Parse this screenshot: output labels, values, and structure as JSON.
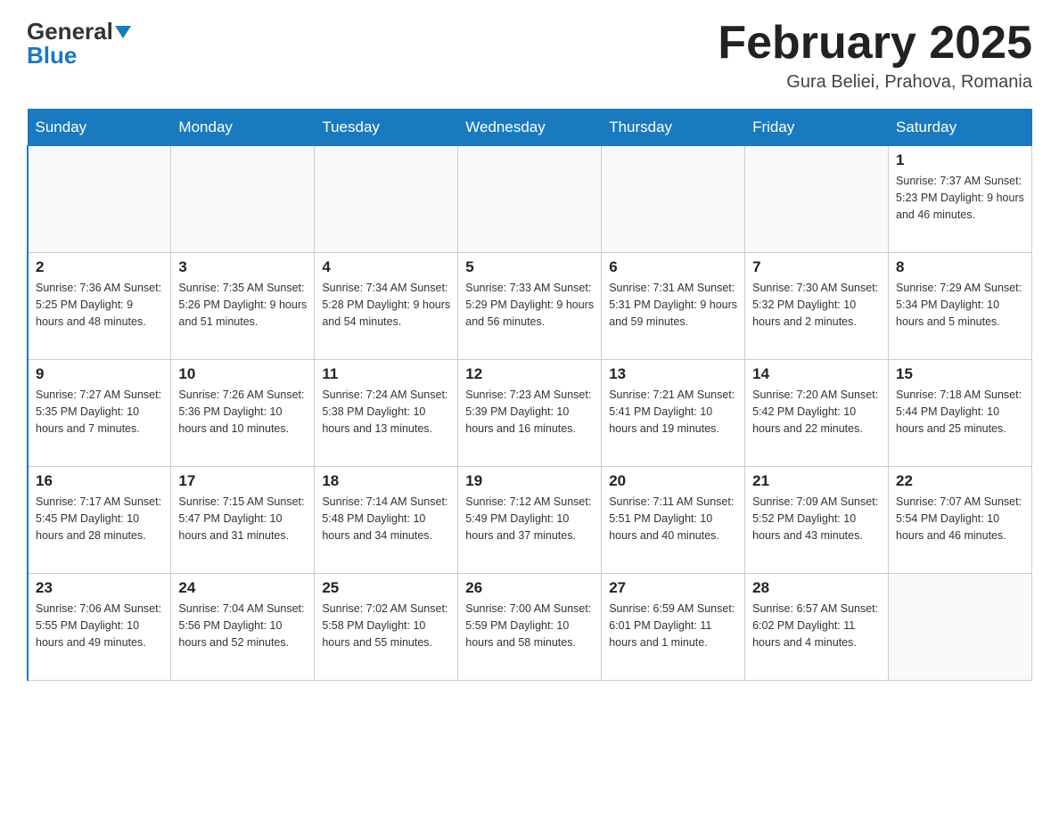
{
  "header": {
    "logo_line1": "General",
    "logo_line2": "Blue",
    "month_title": "February 2025",
    "location": "Gura Beliei, Prahova, Romania"
  },
  "days_of_week": [
    "Sunday",
    "Monday",
    "Tuesday",
    "Wednesday",
    "Thursday",
    "Friday",
    "Saturday"
  ],
  "weeks": [
    [
      {
        "day": "",
        "info": ""
      },
      {
        "day": "",
        "info": ""
      },
      {
        "day": "",
        "info": ""
      },
      {
        "day": "",
        "info": ""
      },
      {
        "day": "",
        "info": ""
      },
      {
        "day": "",
        "info": ""
      },
      {
        "day": "1",
        "info": "Sunrise: 7:37 AM\nSunset: 5:23 PM\nDaylight: 9 hours\nand 46 minutes."
      }
    ],
    [
      {
        "day": "2",
        "info": "Sunrise: 7:36 AM\nSunset: 5:25 PM\nDaylight: 9 hours\nand 48 minutes."
      },
      {
        "day": "3",
        "info": "Sunrise: 7:35 AM\nSunset: 5:26 PM\nDaylight: 9 hours\nand 51 minutes."
      },
      {
        "day": "4",
        "info": "Sunrise: 7:34 AM\nSunset: 5:28 PM\nDaylight: 9 hours\nand 54 minutes."
      },
      {
        "day": "5",
        "info": "Sunrise: 7:33 AM\nSunset: 5:29 PM\nDaylight: 9 hours\nand 56 minutes."
      },
      {
        "day": "6",
        "info": "Sunrise: 7:31 AM\nSunset: 5:31 PM\nDaylight: 9 hours\nand 59 minutes."
      },
      {
        "day": "7",
        "info": "Sunrise: 7:30 AM\nSunset: 5:32 PM\nDaylight: 10 hours\nand 2 minutes."
      },
      {
        "day": "8",
        "info": "Sunrise: 7:29 AM\nSunset: 5:34 PM\nDaylight: 10 hours\nand 5 minutes."
      }
    ],
    [
      {
        "day": "9",
        "info": "Sunrise: 7:27 AM\nSunset: 5:35 PM\nDaylight: 10 hours\nand 7 minutes."
      },
      {
        "day": "10",
        "info": "Sunrise: 7:26 AM\nSunset: 5:36 PM\nDaylight: 10 hours\nand 10 minutes."
      },
      {
        "day": "11",
        "info": "Sunrise: 7:24 AM\nSunset: 5:38 PM\nDaylight: 10 hours\nand 13 minutes."
      },
      {
        "day": "12",
        "info": "Sunrise: 7:23 AM\nSunset: 5:39 PM\nDaylight: 10 hours\nand 16 minutes."
      },
      {
        "day": "13",
        "info": "Sunrise: 7:21 AM\nSunset: 5:41 PM\nDaylight: 10 hours\nand 19 minutes."
      },
      {
        "day": "14",
        "info": "Sunrise: 7:20 AM\nSunset: 5:42 PM\nDaylight: 10 hours\nand 22 minutes."
      },
      {
        "day": "15",
        "info": "Sunrise: 7:18 AM\nSunset: 5:44 PM\nDaylight: 10 hours\nand 25 minutes."
      }
    ],
    [
      {
        "day": "16",
        "info": "Sunrise: 7:17 AM\nSunset: 5:45 PM\nDaylight: 10 hours\nand 28 minutes."
      },
      {
        "day": "17",
        "info": "Sunrise: 7:15 AM\nSunset: 5:47 PM\nDaylight: 10 hours\nand 31 minutes."
      },
      {
        "day": "18",
        "info": "Sunrise: 7:14 AM\nSunset: 5:48 PM\nDaylight: 10 hours\nand 34 minutes."
      },
      {
        "day": "19",
        "info": "Sunrise: 7:12 AM\nSunset: 5:49 PM\nDaylight: 10 hours\nand 37 minutes."
      },
      {
        "day": "20",
        "info": "Sunrise: 7:11 AM\nSunset: 5:51 PM\nDaylight: 10 hours\nand 40 minutes."
      },
      {
        "day": "21",
        "info": "Sunrise: 7:09 AM\nSunset: 5:52 PM\nDaylight: 10 hours\nand 43 minutes."
      },
      {
        "day": "22",
        "info": "Sunrise: 7:07 AM\nSunset: 5:54 PM\nDaylight: 10 hours\nand 46 minutes."
      }
    ],
    [
      {
        "day": "23",
        "info": "Sunrise: 7:06 AM\nSunset: 5:55 PM\nDaylight: 10 hours\nand 49 minutes."
      },
      {
        "day": "24",
        "info": "Sunrise: 7:04 AM\nSunset: 5:56 PM\nDaylight: 10 hours\nand 52 minutes."
      },
      {
        "day": "25",
        "info": "Sunrise: 7:02 AM\nSunset: 5:58 PM\nDaylight: 10 hours\nand 55 minutes."
      },
      {
        "day": "26",
        "info": "Sunrise: 7:00 AM\nSunset: 5:59 PM\nDaylight: 10 hours\nand 58 minutes."
      },
      {
        "day": "27",
        "info": "Sunrise: 6:59 AM\nSunset: 6:01 PM\nDaylight: 11 hours\nand 1 minute."
      },
      {
        "day": "28",
        "info": "Sunrise: 6:57 AM\nSunset: 6:02 PM\nDaylight: 11 hours\nand 4 minutes."
      },
      {
        "day": "",
        "info": ""
      }
    ]
  ]
}
